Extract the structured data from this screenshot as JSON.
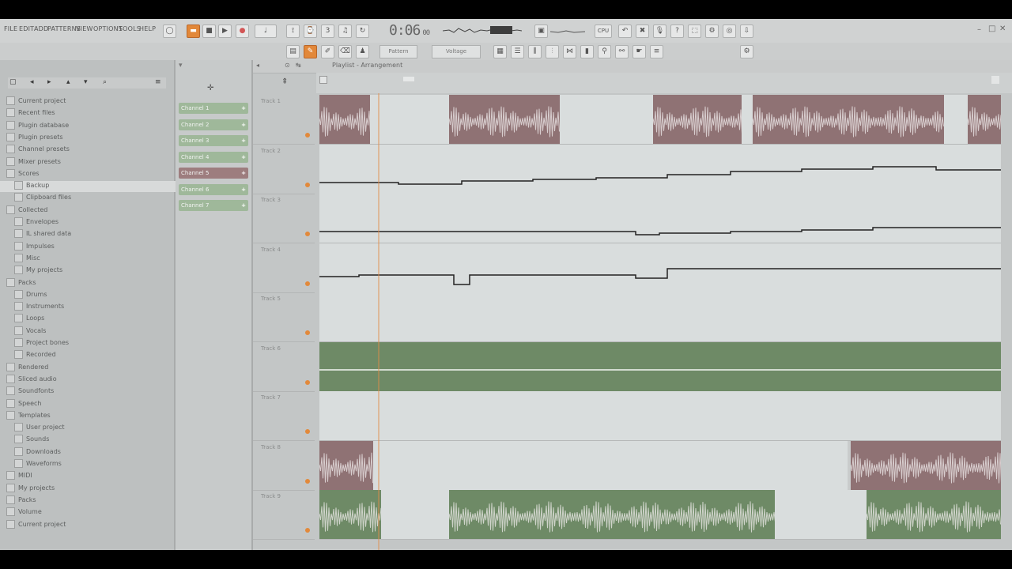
{
  "menu": {
    "items": [
      "FILE",
      "EDIT",
      "ADD",
      "PATTERNS",
      "VIEW",
      "OPTIONS",
      "TOOLS",
      "HELP"
    ]
  },
  "hint_bar": "",
  "transport": {
    "time": "0:06",
    "time_sub": "00"
  },
  "toolbar": {
    "pattern_label": "Pattern",
    "snap_label": "Voltage",
    "cpu_label": "",
    "right_label": ""
  },
  "playlist": {
    "title": "Playlist - Arrangement",
    "subtitle": "",
    "tracks": [
      {
        "name": "Track 1"
      },
      {
        "name": "Track 2"
      },
      {
        "name": "Track 3"
      },
      {
        "name": "Track 4"
      },
      {
        "name": "Track 5"
      },
      {
        "name": "Track 6"
      },
      {
        "name": "Track 7"
      },
      {
        "name": "Track 8"
      },
      {
        "name": "Track 9"
      }
    ]
  },
  "browser": {
    "items": [
      {
        "label": "Current project",
        "indent": 1
      },
      {
        "label": "Recent files",
        "indent": 1
      },
      {
        "label": "Plugin database",
        "indent": 1
      },
      {
        "label": "Plugin presets",
        "indent": 1
      },
      {
        "label": "Channel presets",
        "indent": 1
      },
      {
        "label": "Mixer presets",
        "indent": 1
      },
      {
        "label": "Scores",
        "indent": 1
      },
      {
        "label": "Backup",
        "indent": 2
      },
      {
        "label": "Clipboard files",
        "indent": 2
      },
      {
        "label": "Collected",
        "indent": 1
      },
      {
        "label": "Envelopes",
        "indent": 2
      },
      {
        "label": "IL shared data",
        "indent": 2
      },
      {
        "label": "Impulses",
        "indent": 2
      },
      {
        "label": "Misc",
        "indent": 2
      },
      {
        "label": "My projects",
        "indent": 2
      },
      {
        "label": "Packs",
        "indent": 1
      },
      {
        "label": "Drums",
        "indent": 2
      },
      {
        "label": "Instruments",
        "indent": 2
      },
      {
        "label": "Loops",
        "indent": 2
      },
      {
        "label": "Vocals",
        "indent": 2
      },
      {
        "label": "Project bones",
        "indent": 2
      },
      {
        "label": "Recorded",
        "indent": 2
      },
      {
        "label": "Rendered",
        "indent": 1
      },
      {
        "label": "Sliced audio",
        "indent": 1
      },
      {
        "label": "Soundfonts",
        "indent": 1
      },
      {
        "label": "Speech",
        "indent": 1
      },
      {
        "label": "Templates",
        "indent": 1
      },
      {
        "label": "User project",
        "indent": 2
      },
      {
        "label": "Sounds",
        "indent": 2
      },
      {
        "label": "Downloads",
        "indent": 2
      },
      {
        "label": "Waveforms",
        "indent": 2
      },
      {
        "label": "MIDI",
        "indent": 1
      },
      {
        "label": "My projects",
        "indent": 1
      },
      {
        "label": "Packs",
        "indent": 1
      },
      {
        "label": "Volume",
        "indent": 1
      },
      {
        "label": "Current project",
        "indent": 1
      }
    ]
  },
  "channels": [
    {
      "label": "Channel 1",
      "color": "green"
    },
    {
      "label": "Channel 2",
      "color": "green"
    },
    {
      "label": "Channel 3",
      "color": "green"
    },
    {
      "label": "Channel 4",
      "color": "green"
    },
    {
      "label": "Channel 5",
      "color": "red"
    },
    {
      "label": "Channel 6",
      "color": "green"
    },
    {
      "label": "Channel 7",
      "color": "green"
    }
  ],
  "colors": {
    "maroon_clip": "#8f7274",
    "green_clip": "#6e8a66",
    "accent": "#e2883a",
    "background": "#c5c8c8"
  }
}
